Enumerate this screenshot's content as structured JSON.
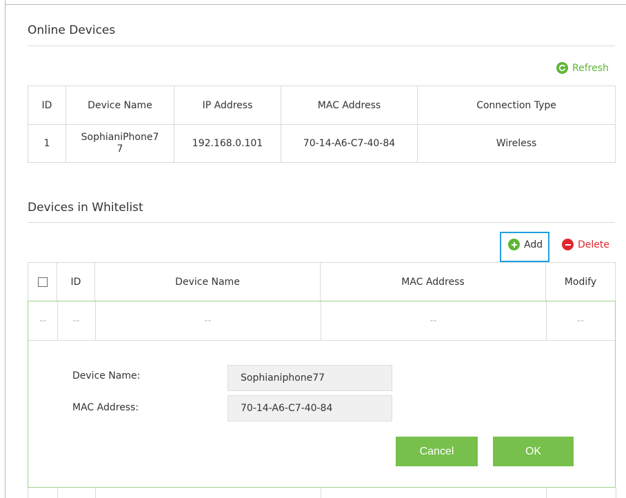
{
  "online": {
    "title": "Online Devices",
    "refresh_label": "Refresh",
    "columns": [
      "ID",
      "Device Name",
      "IP Address",
      "MAC Address",
      "Connection Type"
    ],
    "rows": [
      {
        "id": "1",
        "name_line1": "SophianiPhone7",
        "name_line2": "7",
        "ip": "192.168.0.101",
        "mac": "70-14-A6-C7-40-84",
        "type": "Wireless"
      }
    ]
  },
  "whitelist": {
    "title": "Devices in Whitelist",
    "add_label": "Add",
    "delete_label": "Delete",
    "columns": [
      "ID",
      "Device Name",
      "MAC Address",
      "Modify"
    ],
    "placeholder": "--",
    "form": {
      "device_name_label": "Device Name:",
      "device_name_value": "Sophianiphone77",
      "mac_label": "MAC Address:",
      "mac_value": "70-14-A6-C7-40-84",
      "cancel_label": "Cancel",
      "ok_label": "OK"
    }
  },
  "colors": {
    "accent_green": "#77c04b",
    "delete_red": "#e0252f",
    "highlight_blue": "#1e9ee0"
  }
}
